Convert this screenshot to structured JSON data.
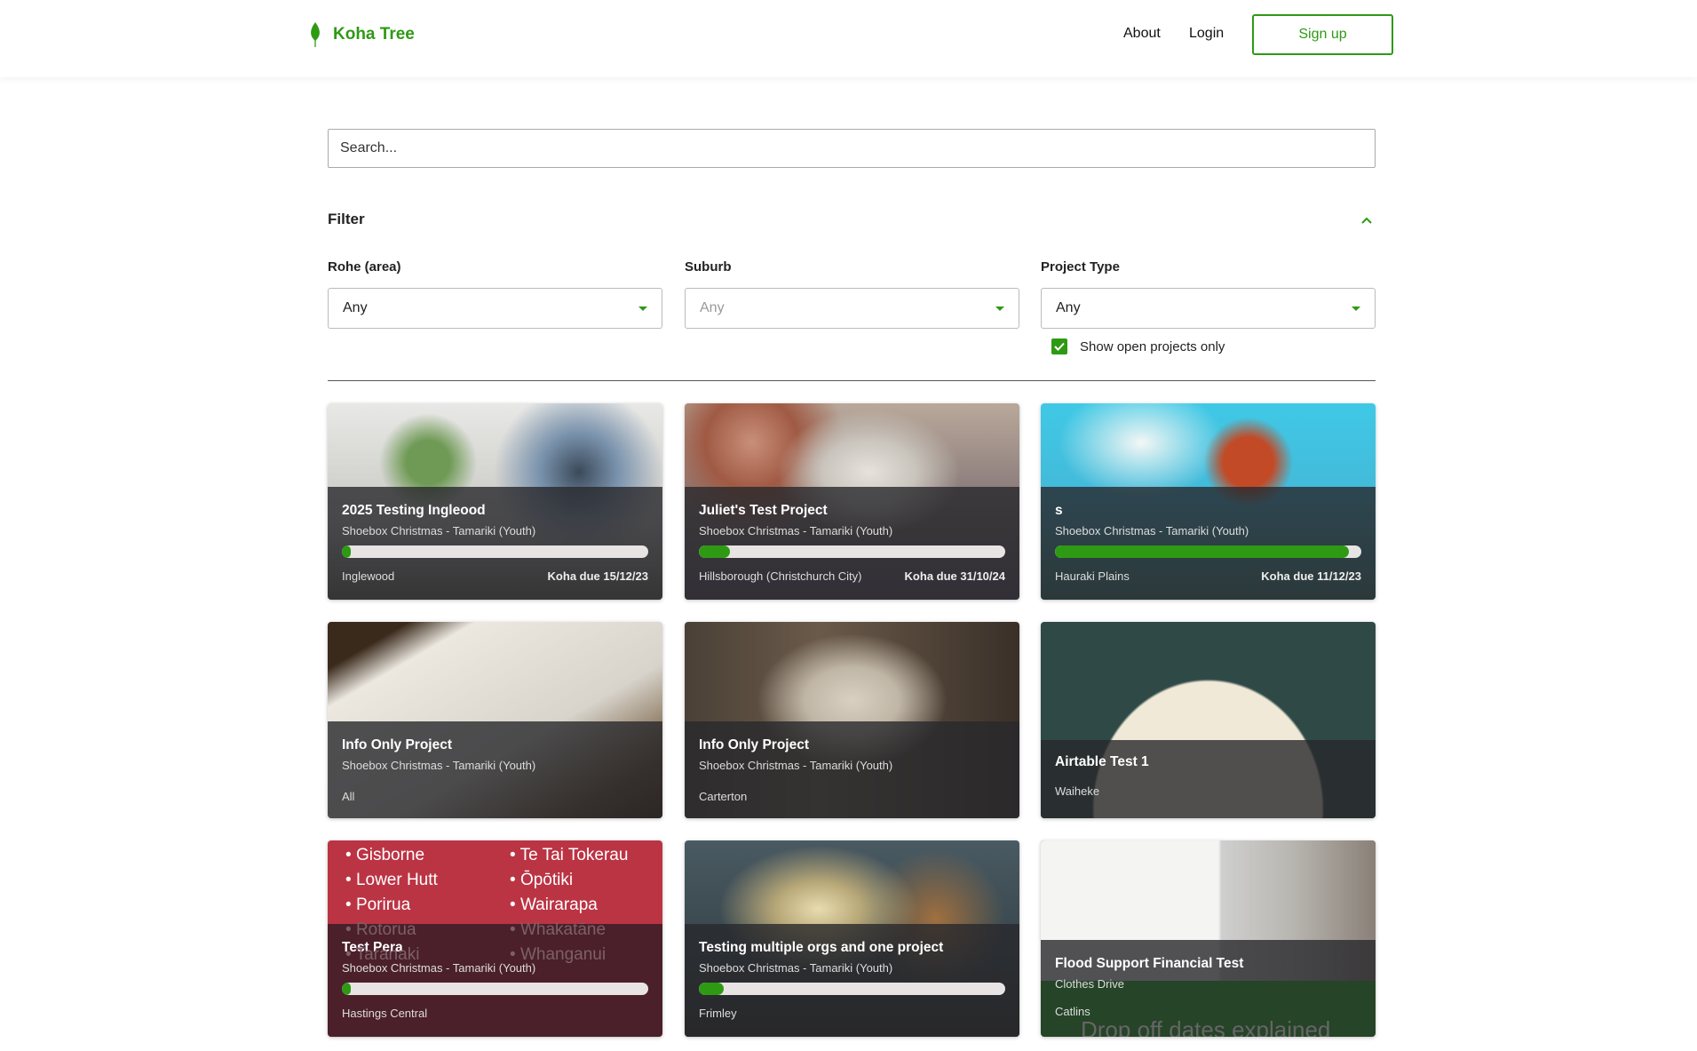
{
  "header": {
    "brand": "Koha Tree",
    "nav": [
      "About",
      "Login"
    ],
    "signup": "Sign up"
  },
  "search": {
    "placeholder": "Search..."
  },
  "filter": {
    "title": "Filter",
    "fields": [
      {
        "label": "Rohe (area)",
        "value": "Any"
      },
      {
        "label": "Suburb",
        "value": "Any"
      },
      {
        "label": "Project Type",
        "value": "Any"
      }
    ],
    "open_only": {
      "label": "Show open projects only",
      "checked": true
    }
  },
  "cards": [
    {
      "title": "2025 Testing Ingleood",
      "type": "Shoebox Christmas - Tamariki (Youth)",
      "progress": 3,
      "location": "Inglewood",
      "due": "Koha due 15/12/23"
    },
    {
      "title": "Juliet's Test Project",
      "type": "Shoebox Christmas - Tamariki (Youth)",
      "progress": 10,
      "location": "Hillsborough (Christchurch City)",
      "due": "Koha due 31/10/24"
    },
    {
      "title": "s",
      "type": "Shoebox Christmas - Tamariki (Youth)",
      "progress": 96,
      "location": "Hauraki Plains",
      "due": "Koha due 11/12/23"
    },
    {
      "title": "Info Only Project",
      "type": "Shoebox Christmas - Tamariki (Youth)",
      "location": "All"
    },
    {
      "title": "Info Only Project",
      "type": "Shoebox Christmas - Tamariki (Youth)",
      "location": "Carterton"
    },
    {
      "title": "Airtable Test 1",
      "location": "Waiheke"
    },
    {
      "title": "Test Pera",
      "type": "Shoebox Christmas - Tamariki (Youth)",
      "progress": 1,
      "location": "Hastings Central",
      "image_regions": [
        "Gisborne",
        "Te Tai Tokerau",
        "Lower Hutt",
        "Ōpōtiki",
        "Porirua",
        "Wairarapa",
        "Rotorua",
        "Whakatāne",
        "Taranaki",
        "Whanganui"
      ]
    },
    {
      "title": "Testing multiple orgs and one project",
      "type": "Shoebox Christmas - Tamariki (Youth)",
      "progress": 8,
      "location": "Frimley"
    },
    {
      "title": "Flood Support Financial Test",
      "type": "Clothes Drive",
      "location": "Catlins",
      "image_text": "Drop off dates explained"
    }
  ],
  "colors": {
    "brand": "#2e9a14",
    "overlay": "#28282c",
    "pera_bg": "#bb3444"
  }
}
